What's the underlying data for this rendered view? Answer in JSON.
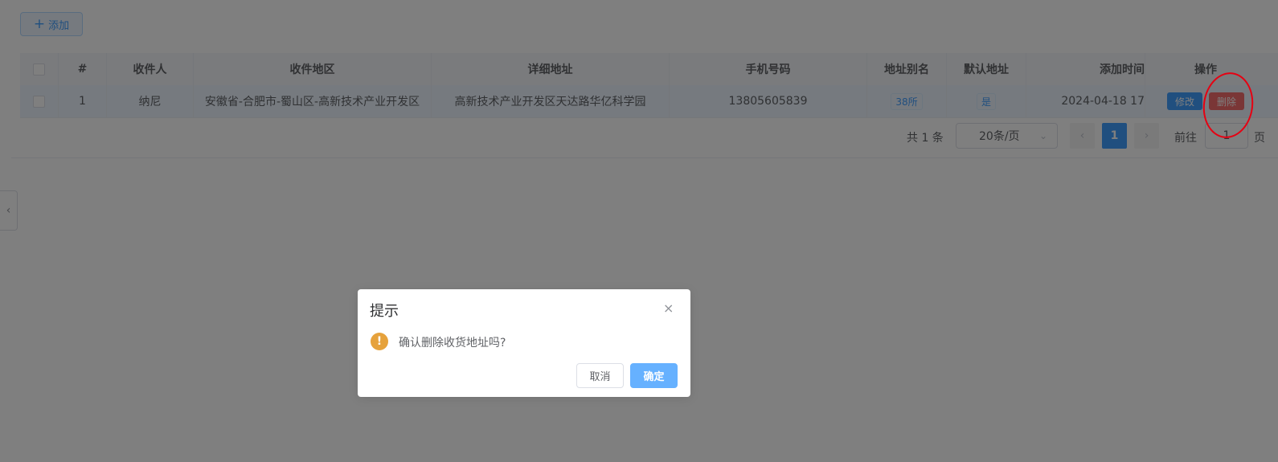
{
  "toolbar": {
    "add_label": "添加",
    "add_icon": "plus-icon"
  },
  "table": {
    "headers": [
      "#",
      "收件人",
      "收件地区",
      "详细地址",
      "手机号码",
      "地址别名",
      "默认地址",
      "添加时间",
      "操作"
    ],
    "rows": [
      {
        "index": "1",
        "recipient": "纳尼",
        "region": "安徽省-合肥市-蜀山区-高新技术产业开发区",
        "address": "高新技术产业开发区天达路华亿科学园",
        "phone": "13805605839",
        "alias": "38所",
        "is_default": "是",
        "added_time": "2024-04-18 17",
        "edit_label": "修改",
        "delete_label": "删除"
      }
    ]
  },
  "pagination": {
    "total": "共 1 条",
    "page_size": "20条/页",
    "current_page": "1",
    "goto_label": "前往",
    "goto_value": "1",
    "unit_label": "页"
  },
  "dialog": {
    "title": "提示",
    "message": "确认删除收货地址吗?",
    "cancel_label": "取消",
    "confirm_label": "确定",
    "warn_glyph": "!",
    "close_glyph": "×"
  },
  "colors": {
    "primary": "#409eff",
    "danger": "#f56c6c",
    "warning": "#e6a23c",
    "annotation": "#e60012"
  }
}
